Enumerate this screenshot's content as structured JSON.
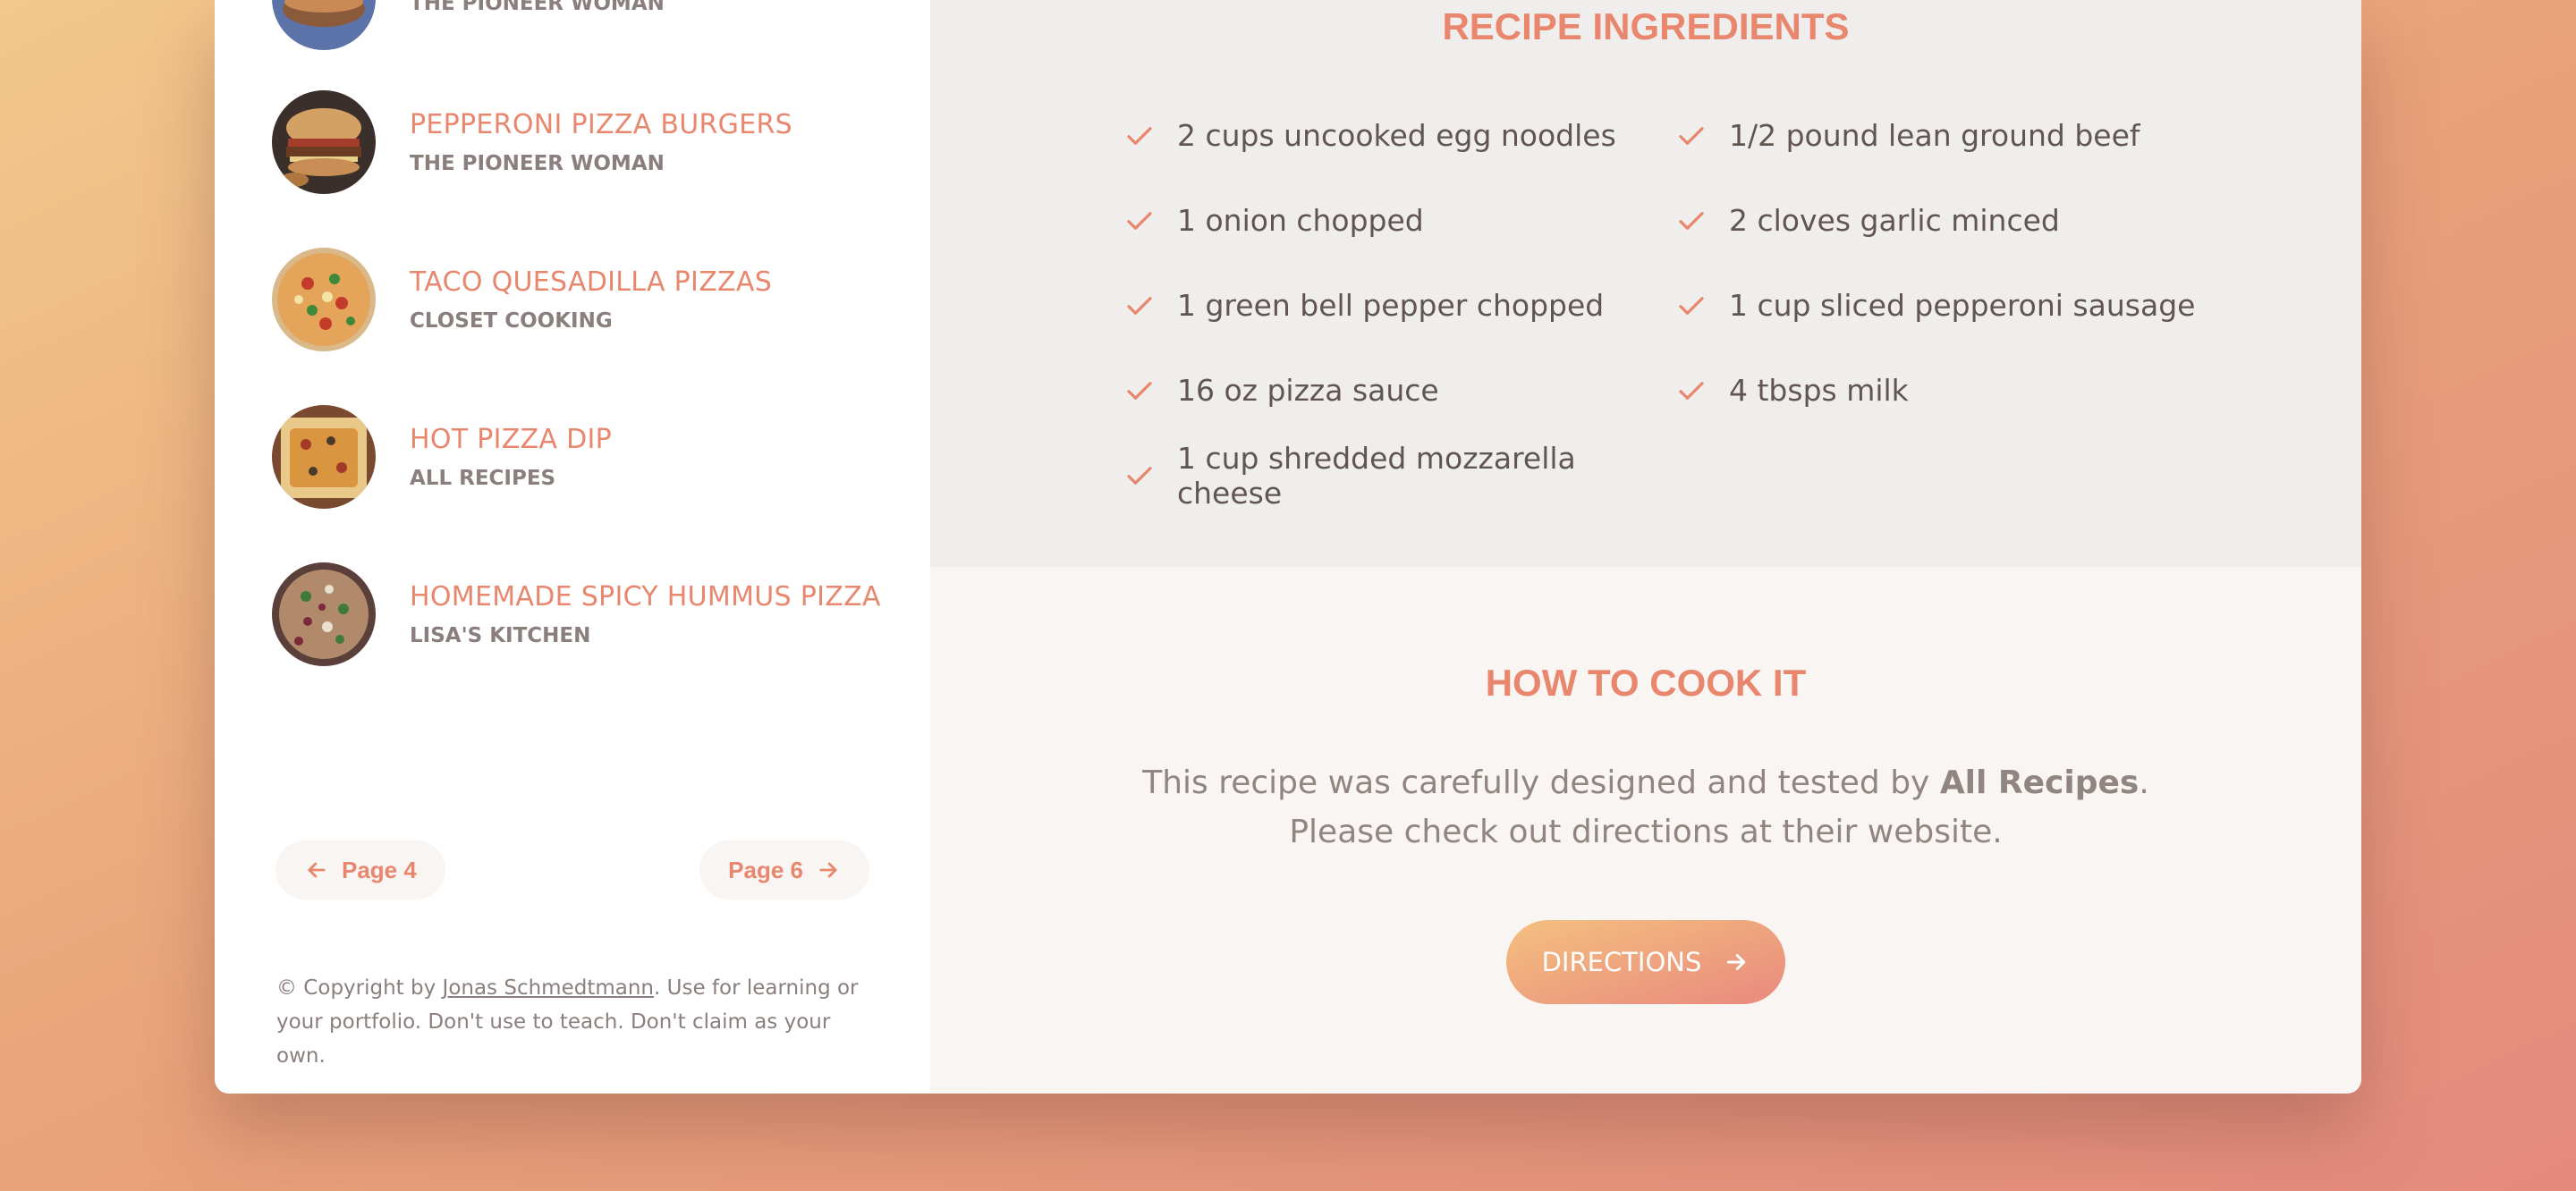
{
  "sidebar": {
    "results": [
      {
        "name": "",
        "publisher": "THE PIONEER WOMAN",
        "image": "burger-thumbnail"
      },
      {
        "name": "PEPPERONI PIZZA BURGERS",
        "publisher": "THE PIONEER WOMAN",
        "image": "burger-thumbnail"
      },
      {
        "name": "TACO QUESADILLA PIZZAS",
        "publisher": "CLOSET COOKING",
        "image": "pizza-thumbnail"
      },
      {
        "name": "HOT PIZZA DIP",
        "publisher": "ALL RECIPES",
        "image": "dip-thumbnail"
      },
      {
        "name": "HOMEMADE SPICY HUMMUS PIZZA",
        "publisher": "LISA'S KITCHEN",
        "image": "hummus-pizza-thumbnail"
      }
    ],
    "pagination": {
      "prev_label": "Page 4",
      "next_label": "Page 6"
    },
    "copyright": {
      "prefix": "© Copyright by ",
      "author": "Jonas Schmedtmann",
      "suffix": ". Use for learning or your portfolio. Don't use to teach. Don't claim as your own."
    }
  },
  "recipe": {
    "ingredients_heading": "RECIPE INGREDIENTS",
    "ingredients": [
      "2 cups uncooked egg noodles",
      "1/2 pound lean ground beef",
      "1 onion chopped",
      "2 cloves garlic minced",
      "1 green bell pepper chopped",
      "1 cup sliced pepperoni sausage",
      "16 oz pizza sauce",
      "4 tbsps milk",
      "1 cup shredded mozzarella cheese"
    ],
    "directions": {
      "heading": "HOW TO COOK IT",
      "text_prefix": "This recipe was carefully designed and tested by ",
      "publisher": "All Recipes",
      "text_suffix": ". Please check out directions at their website.",
      "button_label": "DIRECTIONS"
    }
  },
  "colors": {
    "accent": "#e8876d",
    "text": "#615551",
    "muted": "#918581",
    "ingredients_bg": "#f0eeec",
    "directions_bg": "#f9f5f3"
  }
}
